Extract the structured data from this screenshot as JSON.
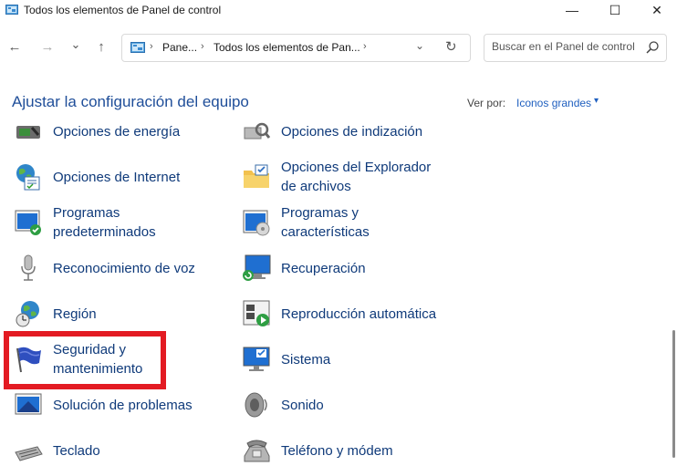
{
  "window": {
    "title": "Todos los elementos de Panel de control",
    "minimize_glyph": "—",
    "maximize_glyph": "☐",
    "close_glyph": "✕"
  },
  "nav": {
    "back_glyph": "←",
    "forward_glyph": "→",
    "recent_glyph": "⌄",
    "up_glyph": "↑"
  },
  "address": {
    "crumbs": [
      "Pane...",
      "Todos los elementos de Pan..."
    ],
    "separator": "›",
    "dropdown_glyph": "⌄",
    "refresh_glyph": "↻"
  },
  "search": {
    "placeholder": "Buscar en el Panel de control"
  },
  "content": {
    "heading": "Ajustar la configuración del equipo",
    "view_by_label": "Ver por:",
    "view_by_value": "Iconos grandes",
    "caret": "▾"
  },
  "items": [
    {
      "label": "Opciones de energía",
      "icon": "power-options-icon"
    },
    {
      "label": "Opciones de indización",
      "icon": "indexing-options-icon"
    },
    {
      "label": "Opciones de Internet",
      "icon": "internet-options-icon"
    },
    {
      "label_lines": [
        "Opciones del Explorador",
        "de archivos"
      ],
      "icon": "folder-options-icon"
    },
    {
      "label_lines": [
        "Programas",
        "predeterminados"
      ],
      "icon": "default-programs-icon"
    },
    {
      "label_lines": [
        "Programas y",
        "características"
      ],
      "icon": "programs-features-icon"
    },
    {
      "label": "Reconocimiento de voz",
      "icon": "microphone-icon"
    },
    {
      "label": "Recuperación",
      "icon": "recovery-icon"
    },
    {
      "label": "Región",
      "icon": "region-icon"
    },
    {
      "label": "Reproducción automática",
      "icon": "autoplay-icon"
    },
    {
      "label_lines": [
        "Seguridad y",
        "mantenimiento"
      ],
      "icon": "security-flag-icon"
    },
    {
      "label": "Sistema",
      "icon": "system-icon"
    },
    {
      "label": "Solución de problemas",
      "icon": "troubleshooting-icon"
    },
    {
      "label": "Sonido",
      "icon": "speaker-icon"
    },
    {
      "label": "Teclado",
      "icon": "keyboard-icon"
    },
    {
      "label": "Teléfono y módem",
      "icon": "phone-modem-icon"
    }
  ],
  "colors": {
    "link_blue": "#0f3a7a",
    "heading_blue": "#1f4e99",
    "highlight_red": "#e31b23"
  }
}
